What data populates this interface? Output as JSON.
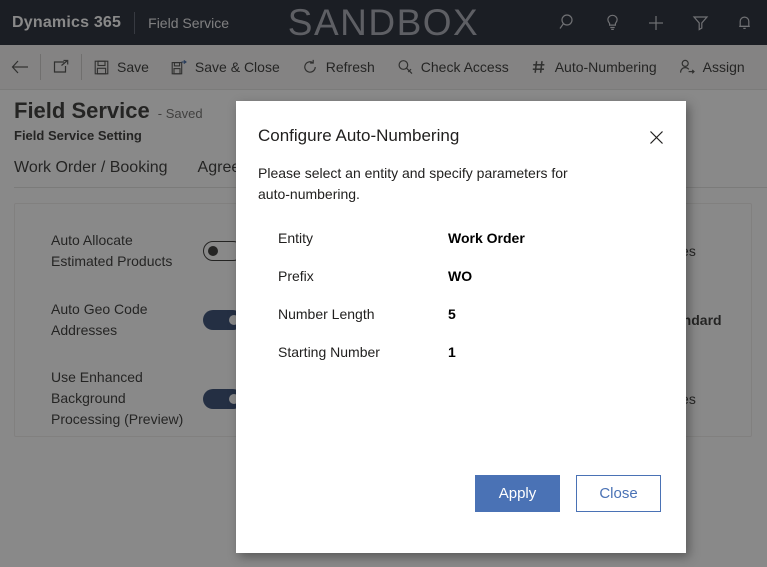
{
  "topbar": {
    "brand": "Dynamics 365",
    "app_name": "Field Service",
    "environment_label": "SANDBOX",
    "icons": [
      {
        "name": "search-icon",
        "label": "Search"
      },
      {
        "name": "lightbulb-icon",
        "label": "Assistant"
      },
      {
        "name": "plus-icon",
        "label": "Quick create"
      },
      {
        "name": "filter-icon",
        "label": "Filter"
      },
      {
        "name": "bell-icon",
        "label": "Notifications"
      }
    ],
    "colors": {
      "background": "#0d1220",
      "sandbox_text": "#9fa3ad"
    }
  },
  "commandbar": {
    "back_label": "Back",
    "popout_label": "Open in new window",
    "buttons": [
      {
        "icon": "save-icon",
        "label": "Save"
      },
      {
        "icon": "save-and-close-icon",
        "label": "Save & Close"
      },
      {
        "icon": "refresh-icon",
        "label": "Refresh"
      },
      {
        "icon": "check-access-icon",
        "label": "Check Access"
      },
      {
        "icon": "hash-icon",
        "label": "Auto-Numbering"
      },
      {
        "icon": "assign-icon",
        "label": "Assign"
      }
    ]
  },
  "page": {
    "title": "Field Service",
    "saved_status": "- Saved",
    "subtitle": "Field Service Setting",
    "tabs": [
      {
        "label": "Work Order / Booking"
      },
      {
        "label": "Agreement"
      }
    ],
    "settings": [
      {
        "label": "Auto Allocate Estimated Products",
        "toggle_state": "off",
        "value_text": "Yes"
      },
      {
        "label": "Auto Geo Code Addresses",
        "toggle_state": "on",
        "value_text": "/Standard"
      },
      {
        "label": "Use Enhanced Background Processing (Preview)",
        "toggle_state": "on",
        "value_text": "Yes"
      }
    ]
  },
  "dialog": {
    "title": "Configure Auto-Numbering",
    "close_label": "Close",
    "description": "Please select an entity and specify parameters for auto-numbering.",
    "fields": [
      {
        "label": "Entity",
        "value": "Work Order"
      },
      {
        "label": "Prefix",
        "value": "WO"
      },
      {
        "label": "Number Length",
        "value": "5"
      },
      {
        "label": "Starting Number",
        "value": "1"
      }
    ],
    "apply_label": "Apply",
    "close_button_label": "Close",
    "colors": {
      "primary": "#4a72b5",
      "surface": "#ffffff"
    }
  }
}
